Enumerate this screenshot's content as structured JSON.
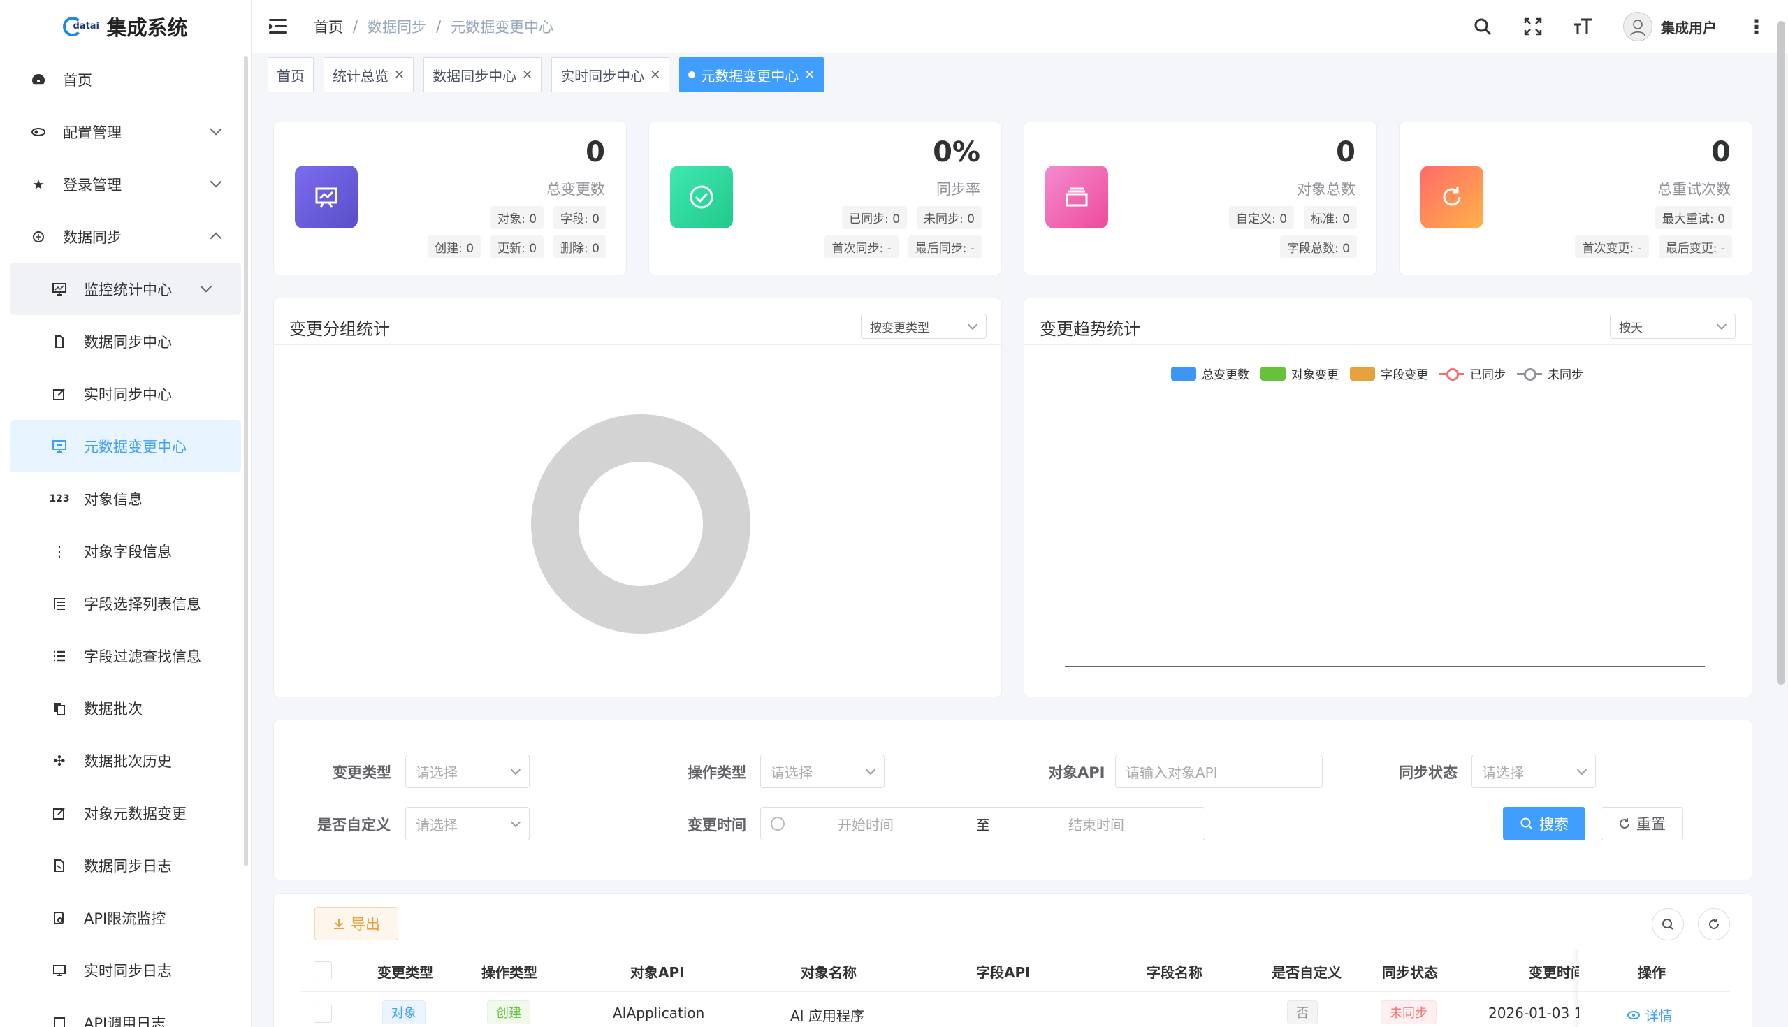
{
  "app": {
    "title": "集成系统",
    "logo_text": "datai"
  },
  "sidebar": {
    "items": [
      {
        "label": "首页",
        "icon": "dashboard-icon"
      },
      {
        "label": "配置管理",
        "icon": "eye-icon"
      },
      {
        "label": "登录管理",
        "icon": "star-icon"
      },
      {
        "label": "数据同步",
        "icon": "cube-icon"
      }
    ],
    "sub": [
      {
        "label": "监控统计中心",
        "icon": "chart-icon"
      },
      {
        "label": "数据同步中心",
        "icon": "doc-icon"
      },
      {
        "label": "实时同步中心",
        "icon": "edit-icon"
      },
      {
        "label": "元数据变更中心",
        "icon": "monitor-icon"
      },
      {
        "label": "对象信息",
        "icon": "number-icon"
      },
      {
        "label": "对象字段信息",
        "icon": "dots-icon"
      },
      {
        "label": "字段选择列表信息",
        "icon": "tree-icon"
      },
      {
        "label": "字段过滤查找信息",
        "icon": "list-icon"
      },
      {
        "label": "数据批次",
        "icon": "copy-icon"
      },
      {
        "label": "数据批次历史",
        "icon": "move-icon"
      },
      {
        "label": "对象元数据变更",
        "icon": "edit2-icon"
      },
      {
        "label": "数据同步日志",
        "icon": "log-icon"
      },
      {
        "label": "API限流监控",
        "icon": "gauge-icon"
      },
      {
        "label": "实时同步日志",
        "icon": "screen-icon"
      },
      {
        "label": "API调用日志",
        "icon": "api-icon"
      }
    ]
  },
  "header": {
    "breadcrumb": [
      "首页",
      "数据同步",
      "元数据变更中心"
    ],
    "user": "集成用户"
  },
  "tags": [
    "首页",
    "统计总览",
    "数据同步中心",
    "实时同步中心",
    "元数据变更中心"
  ],
  "stats": [
    {
      "value": "0",
      "label": "总变更数",
      "row1": [
        "对象: 0",
        "字段: 0"
      ],
      "row2": [
        "创建: 0",
        "更新: 0",
        "删除: 0"
      ],
      "color": "#6a5acd"
    },
    {
      "value": "0%",
      "label": "同步率",
      "row1": [
        "已同步: 0",
        "未同步: 0"
      ],
      "row2": [
        "首次同步: -",
        "最后同步: -"
      ],
      "color": "#2ed8a3"
    },
    {
      "value": "0",
      "label": "对象总数",
      "row1": [
        "自定义: 0",
        "标准: 0"
      ],
      "row2": [
        "字段总数: 0"
      ],
      "color": "#f06cb4"
    },
    {
      "value": "0",
      "label": "总重试次数",
      "row1": [
        "最大重试: 0"
      ],
      "row2": [
        "首次变更: -",
        "最后变更: -"
      ],
      "color": "#ff7b5a"
    }
  ],
  "group_panel": {
    "title": "变更分组统计",
    "select": "按变更类型"
  },
  "trend_panel": {
    "title": "变更趋势统计",
    "select": "按天",
    "legend": [
      {
        "name": "总变更数",
        "color": "#3d96f3",
        "type": "box"
      },
      {
        "name": "对象变更",
        "color": "#67c23a",
        "type": "box"
      },
      {
        "name": "字段变更",
        "color": "#e6a23c",
        "type": "box"
      },
      {
        "name": "已同步",
        "color": "#f56c6c",
        "type": "line"
      },
      {
        "name": "未同步",
        "color": "#909399",
        "type": "line"
      }
    ]
  },
  "search": {
    "change_type_label": "变更类型",
    "op_type_label": "操作类型",
    "object_api_label": "对象API",
    "sync_status_label": "同步状态",
    "custom_label": "是否自定义",
    "change_time_label": "变更时间",
    "select_placeholder": "请选择",
    "object_api_placeholder": "请输入对象API",
    "start_time": "开始时间",
    "to": "至",
    "end_time": "结束时间",
    "search_btn": "搜索",
    "reset_btn": "重置"
  },
  "table": {
    "export_btn": "导出",
    "columns": [
      "变更类型",
      "操作类型",
      "对象API",
      "对象名称",
      "字段API",
      "字段名称",
      "是否自定义",
      "同步状态",
      "变更时间",
      "操作"
    ],
    "row": {
      "change_type": "对象",
      "op_type": "创建",
      "object_api": "AIApplication",
      "object_name": "AI 应用程序",
      "field_api": "",
      "field_name": "",
      "custom": "否",
      "sync_status": "未同步",
      "change_time": "2026-01-03 1",
      "action": "详情"
    }
  }
}
